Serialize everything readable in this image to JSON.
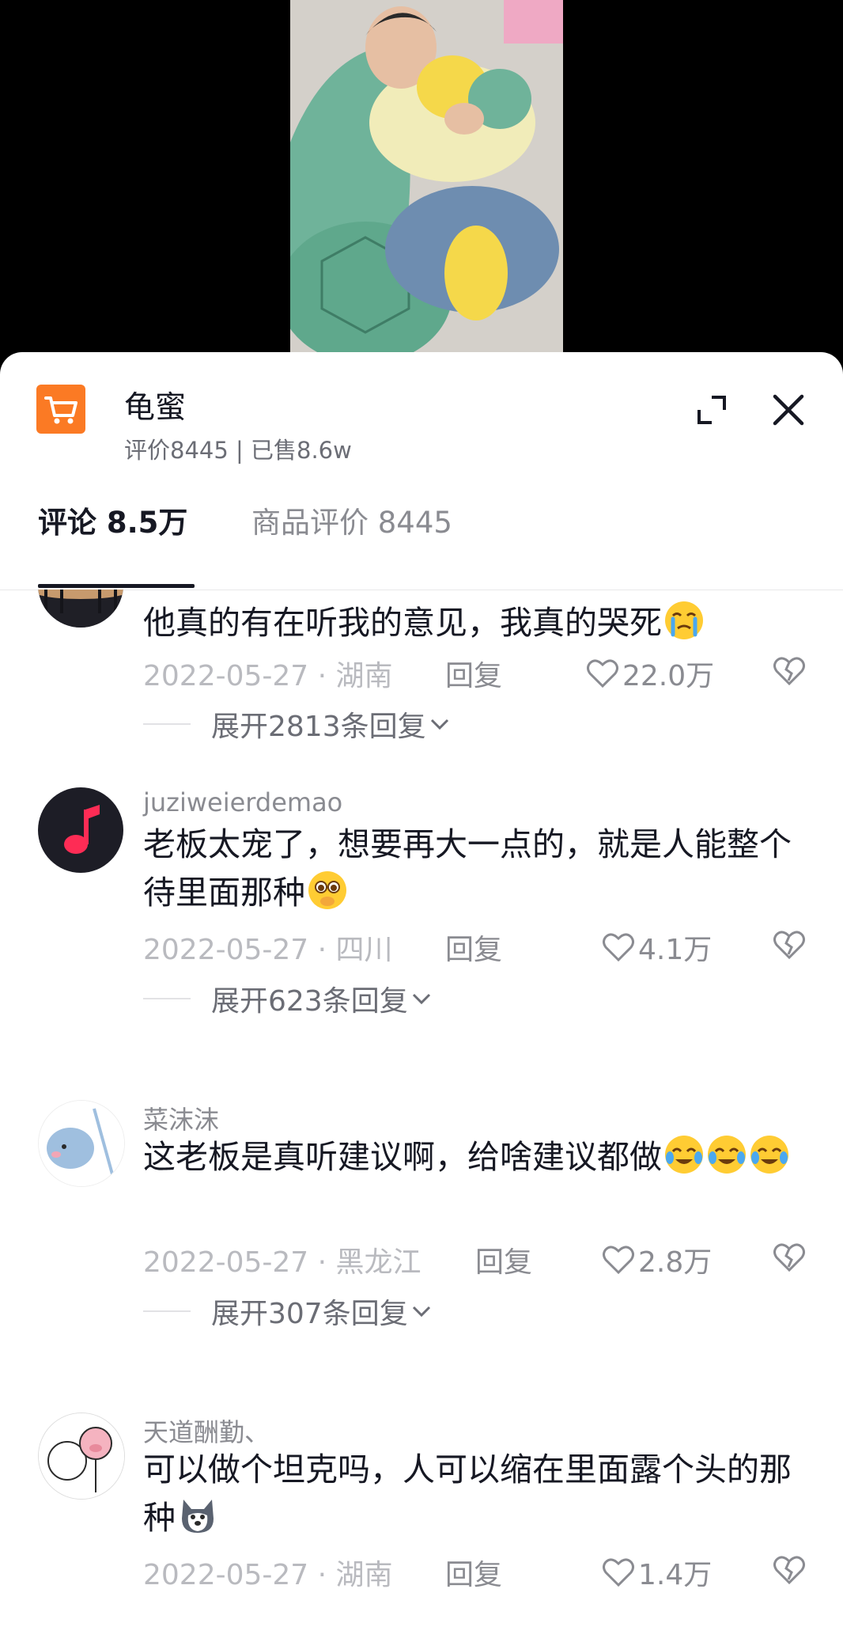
{
  "product": {
    "title": "龟蜜",
    "stats": "评价8445 | 已售8.6w"
  },
  "tabs": [
    {
      "label": "评论 8.5万"
    },
    {
      "label": "商品评价 8445"
    }
  ],
  "comments": [
    {
      "username": "",
      "text": "他真的有在听我的意见，我真的哭死",
      "emoji": "crying-emoji",
      "date": "2022-05-27 · 湖南",
      "reply": "回复",
      "likes": "22.0万",
      "expand": "展开2813条回复"
    },
    {
      "username": "juziweierdemao",
      "text": "老板太宠了，想要再大一点的，就是人能整个待里面那种",
      "emoji": "pleading-emoji",
      "date": "2022-05-27 · 四川",
      "reply": "回复",
      "likes": "4.1万",
      "expand": "展开623条回复"
    },
    {
      "username": "菜沫沫",
      "text": "这老板是真听建议啊，给啥建议都做",
      "emoji": "laugh-cry-emoji",
      "date": "2022-05-27 · 黑龙江",
      "reply": "回复",
      "likes": "2.8万",
      "expand": "展开307条回复"
    },
    {
      "username": "天道酬勤、",
      "text": "可以做个坦克吗，人可以缩在里面露个头的那种",
      "emoji": "husky-emoji",
      "date": "2022-05-27 · 湖南",
      "reply": "回复",
      "likes": "1.4万",
      "expand": ""
    }
  ],
  "colors": {
    "brand_orange": "#fb7a24",
    "text_primary": "#161823",
    "text_secondary": "#8a8b91",
    "music_red": "#fe2c55"
  }
}
